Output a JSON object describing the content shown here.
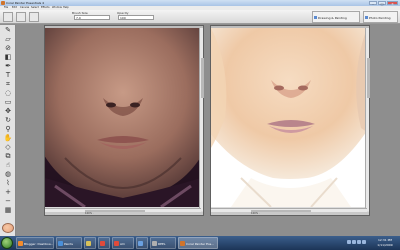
{
  "app": {
    "title": "Corel Painter Essentials 4",
    "window_controls": {
      "minimize": "–",
      "maximize": "□",
      "close": "✕"
    }
  },
  "menu": [
    "File",
    "Edit",
    "Canvas",
    "Select",
    "Effects",
    "Window",
    "Help"
  ],
  "property_bar": {
    "brush_size_label": "Brush Size",
    "brush_size_value": "7.0",
    "opacity_label": "Opacity",
    "opacity_value": "100",
    "layout_dropdown_1": "Drawing & Painting",
    "layout_dropdown_2": "Photo Painting"
  },
  "tools": [
    "brush-tool",
    "eraser-tool",
    "dropper-tool",
    "paint-bucket-tool",
    "pen-tool",
    "text-tool",
    "crop-tool",
    "lasso-tool",
    "rectangle-select-tool",
    "move-tool",
    "rotate-tool",
    "magnifier-tool",
    "grabber-tool",
    "shape-tool",
    "clone-tool",
    "smudge-tool",
    "blender-tool",
    "distort-tool",
    "zoom-in-tool",
    "zoom-out-tool"
  ],
  "documents": {
    "left": {
      "status": "100% ·"
    },
    "right": {
      "status": "100% ·"
    }
  },
  "taskbar": {
    "tasks": [
      {
        "label": "Blogger: Dashboa...",
        "color": "#f28b2b"
      },
      {
        "label": "Paints",
        "color": "#4a8fd8"
      },
      {
        "label": "",
        "color": "#d8c25a"
      },
      {
        "label": "",
        "color": "#e04a3a"
      },
      {
        "label": "Alli",
        "color": "#e04a3a"
      },
      {
        "label": "",
        "color": "#6aa0e0"
      },
      {
        "label": "REEL",
        "color": "#b0b0b0"
      },
      {
        "label": "Corel Painter Ess...",
        "color": "#d0742b"
      }
    ],
    "clock_time": "12:31 PM",
    "clock_date": "1/11/2009"
  }
}
